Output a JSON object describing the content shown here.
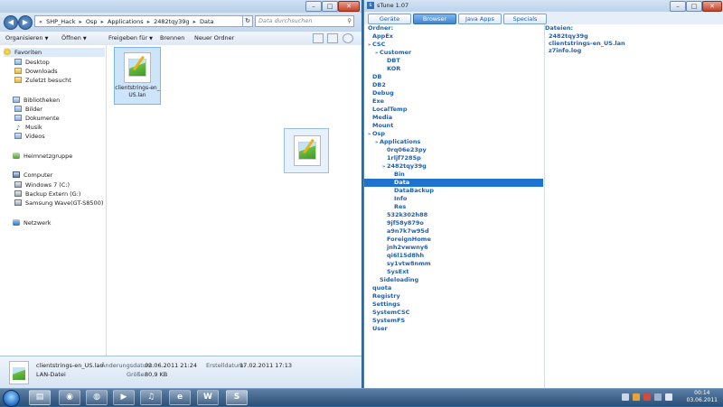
{
  "explorer": {
    "address": {
      "prefix": "«",
      "parts": [
        "SHP_Hack",
        "Osp",
        "Applications",
        "2482tqy39g",
        "Data"
      ],
      "separator": "▸"
    },
    "search_placeholder": "Data durchsuchen",
    "toolbar": {
      "organize": "Organisieren",
      "open": "Öffnen",
      "share": "Freigeben für",
      "burn": "Brennen",
      "new_folder": "Neuer Ordner"
    },
    "nav": {
      "favorites": "Favoriten",
      "desktop": "Desktop",
      "downloads": "Downloads",
      "recent": "Zuletzt besucht",
      "libraries": "Bibliotheken",
      "pictures": "Bilder",
      "documents": "Dokumente",
      "music": "Musik",
      "videos": "Videos",
      "homegroup": "Heimnetzgruppe",
      "computer": "Computer",
      "drive_c": "Windows 7 (C:)",
      "drive_g": "Backup Extern (G:)",
      "device": "Samsung Wave(GT-S8500)",
      "network": "Netzwerk"
    },
    "file": {
      "name_line1": "clientstrings-en_",
      "name_line2": "US.lan"
    },
    "details": {
      "filename": "clientstrings-en_US.lan",
      "modified_label": "Änderungsdatum:",
      "modified_value": "02.06.2011 21:24",
      "created_label": "Erstelldatum:",
      "created_value": "17.02.2011 17:13",
      "type": "LAN-Datei",
      "size_label": "Größe:",
      "size_value": "80,9 KB"
    }
  },
  "stune": {
    "title": "sTune 1.07",
    "tabs": [
      "Geräte",
      "Browser",
      "Java Apps",
      "Specials"
    ],
    "active_tab": "Browser",
    "folders_header": "Ordner:",
    "files_header": "Dateien:",
    "tree": [
      {
        "label": "AppEx",
        "indent": 0,
        "expander": ""
      },
      {
        "label": "CSC",
        "indent": 0,
        "expander": "»"
      },
      {
        "label": "Customer",
        "indent": 1,
        "expander": "»"
      },
      {
        "label": "DBT",
        "indent": 2,
        "expander": ""
      },
      {
        "label": "KOR",
        "indent": 2,
        "expander": ""
      },
      {
        "label": "DB",
        "indent": 0,
        "expander": ""
      },
      {
        "label": "DB2",
        "indent": 0,
        "expander": ""
      },
      {
        "label": "Debug",
        "indent": 0,
        "expander": ""
      },
      {
        "label": "Exe",
        "indent": 0,
        "expander": ""
      },
      {
        "label": "LocalTemp",
        "indent": 0,
        "expander": ""
      },
      {
        "label": "Media",
        "indent": 0,
        "expander": ""
      },
      {
        "label": "Mount",
        "indent": 0,
        "expander": ""
      },
      {
        "label": "Osp",
        "indent": 0,
        "expander": "»"
      },
      {
        "label": "Applications",
        "indent": 1,
        "expander": "»"
      },
      {
        "label": "0rq06e23py",
        "indent": 2,
        "expander": ""
      },
      {
        "label": "1rljf7285p",
        "indent": 2,
        "expander": ""
      },
      {
        "label": "2482tqy39g",
        "indent": 2,
        "expander": "»"
      },
      {
        "label": "Bin",
        "indent": 3,
        "expander": ""
      },
      {
        "label": "Data",
        "indent": 3,
        "expander": "",
        "selected": true
      },
      {
        "label": "DataBackup",
        "indent": 3,
        "expander": ""
      },
      {
        "label": "Info",
        "indent": 3,
        "expander": ""
      },
      {
        "label": "Res",
        "indent": 3,
        "expander": ""
      },
      {
        "label": "532k302h88",
        "indent": 2,
        "expander": ""
      },
      {
        "label": "9jf58y879o",
        "indent": 2,
        "expander": ""
      },
      {
        "label": "a9n7k7w95d",
        "indent": 2,
        "expander": ""
      },
      {
        "label": "ForeignHome",
        "indent": 2,
        "expander": ""
      },
      {
        "label": "jnh2vwwny6",
        "indent": 2,
        "expander": ""
      },
      {
        "label": "qi6l15d8hh",
        "indent": 2,
        "expander": ""
      },
      {
        "label": "sy1vtw8nmm",
        "indent": 2,
        "expander": ""
      },
      {
        "label": "SysExt",
        "indent": 2,
        "expander": ""
      },
      {
        "label": "Sideloading",
        "indent": 1,
        "expander": ""
      },
      {
        "label": "quota",
        "indent": 0,
        "expander": ""
      },
      {
        "label": "Registry",
        "indent": 0,
        "expander": ""
      },
      {
        "label": "Settings",
        "indent": 0,
        "expander": ""
      },
      {
        "label": "SystemCSC",
        "indent": 0,
        "expander": ""
      },
      {
        "label": "SystemFS",
        "indent": 0,
        "expander": ""
      },
      {
        "label": "User",
        "indent": 0,
        "expander": ""
      }
    ],
    "files": [
      "2482tqy39g",
      "clientstrings-en_US.lan",
      "z7info.log"
    ]
  },
  "taskbar": {
    "clock_time": "00:14",
    "clock_date": "03.06.2011",
    "word_glyph": "W",
    "stune_glyph": "S"
  },
  "colors": {
    "accent": "#1f5fb2",
    "selection": "#1e73d1"
  }
}
